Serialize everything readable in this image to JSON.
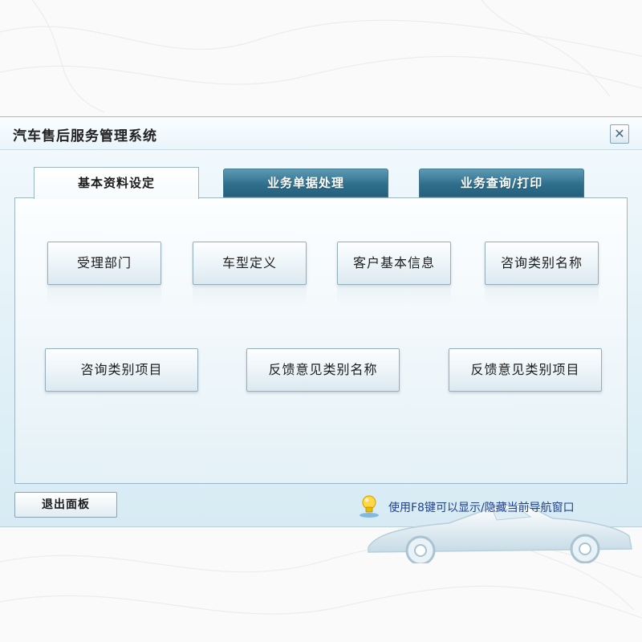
{
  "window": {
    "title": "汽车售后服务管理系统",
    "close_glyph": "✕"
  },
  "tabs": [
    {
      "label": "基本资料设定",
      "active": true
    },
    {
      "label": "业务单据处理",
      "active": false
    },
    {
      "label": "业务查询/打印",
      "active": false
    }
  ],
  "buttons_row1": [
    {
      "label": "受理部门"
    },
    {
      "label": "车型定义"
    },
    {
      "label": "客户基本信息"
    },
    {
      "label": "咨询类别名称"
    }
  ],
  "buttons_row2": [
    {
      "label": "咨询类别项目"
    },
    {
      "label": "反馈意见类别名称"
    },
    {
      "label": "反馈意见类别项目"
    }
  ],
  "footer": {
    "exit_label": "退出面板",
    "hint_text": "使用F8键可以显示/隐藏当前导航窗口"
  },
  "colors": {
    "tab_inactive": "#2f6f8c",
    "hint_text": "#1f3f8f"
  }
}
